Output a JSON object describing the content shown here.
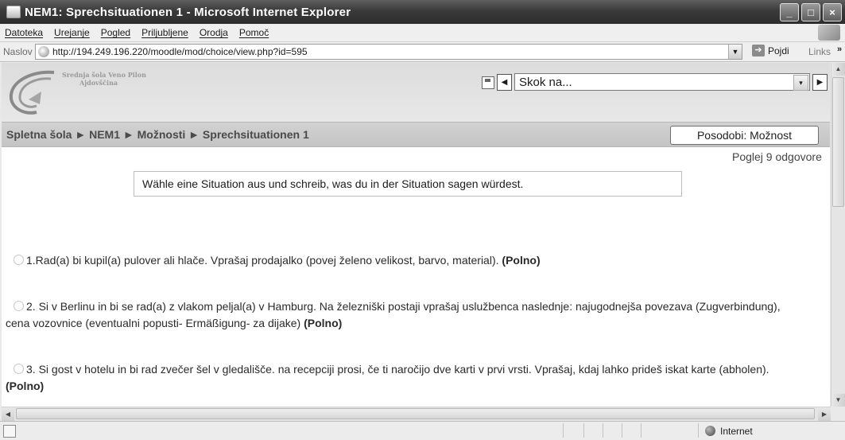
{
  "window": {
    "title": "NEM1: Sprechsituationen 1 - Microsoft Internet Explorer",
    "minimize": "_",
    "maximize": "□",
    "close": "×"
  },
  "menu": {
    "items": [
      "Datoteka",
      "Urejanje",
      "Pogled",
      "Priljubljene",
      "Orodja",
      "Pomoč"
    ]
  },
  "address_bar": {
    "label": "Naslov",
    "url": "http://194.249.196.220/moodle/mod/choice/view.php?id=595",
    "go_label": "Pojdi",
    "links_label": "Links",
    "links_chevron": "»"
  },
  "site": {
    "logo_line1": "Srednja šola Veno Pilon",
    "logo_line2": "Ajdovščina"
  },
  "jump": {
    "prev": "◀",
    "next": "▶",
    "select_value": "Skok na...",
    "dropdown_arrow": "▾"
  },
  "navbar": {
    "breadcrumb": "Spletna šola ► NEM1 ► Možnosti ► Sprechsituationen 1",
    "update_button": "Posodobi: Možnost"
  },
  "main": {
    "view_responses": "Poglej 9 odgovore",
    "question": "Wähle eine Situation aus und schreib, was du in der Situation sagen würdest.",
    "options": [
      {
        "text": "1.Rad(a) bi kupil(a) pulover ali hlače. Vprašaj prodajalko (povej želeno velikost, barvo, material).",
        "status": "(Polno)"
      },
      {
        "text": "2. Si v Berlinu in bi se rad(a) z vlakom peljal(a) v Hamburg. Na železniški postaji vprašaj uslužbenca naslednje: najugodnejša povezava (Zugverbindung), cena vozovnice (eventualni popusti- Ermäßigung- za dijake)",
        "status": "(Polno)"
      },
      {
        "text": "3. Si gost v hotelu in bi rad zvečer šel v gledališče. na recepciji prosi, če ti naročijo dve karti v prvi vrsti. Vprašaj, kdaj lahko prideš iskat karte (abholen).",
        "status": "(Polno)"
      }
    ]
  },
  "scrollbars": {
    "up": "▲",
    "down": "▼",
    "left": "◀",
    "right": "▶"
  },
  "status_bar": {
    "zone": "Internet"
  }
}
